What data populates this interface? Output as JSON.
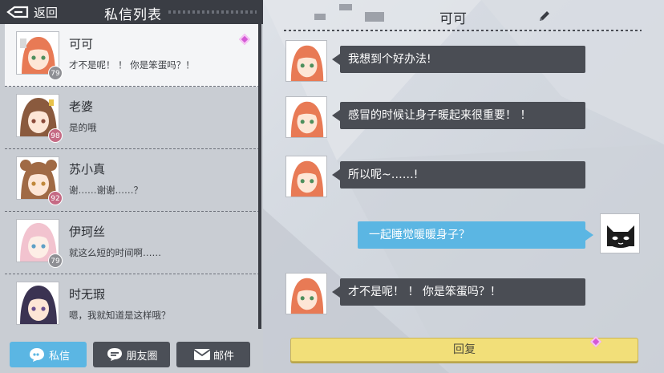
{
  "header": {
    "back_label": "返回",
    "list_title": "私信列表"
  },
  "contacts": [
    {
      "name": "可可",
      "preview": "才不是呢！ ！  你是笨蛋吗？！",
      "level": "79",
      "selected": true,
      "unread": true
    },
    {
      "name": "老婆",
      "preview": "是的哦",
      "level": "98",
      "selected": false,
      "unread": false
    },
    {
      "name": "苏小真",
      "preview": "谢……谢谢……？",
      "level": "92",
      "selected": false,
      "unread": false
    },
    {
      "name": "伊珂丝",
      "preview": "就这么短的时间啊……",
      "level": "79",
      "selected": false,
      "unread": false
    },
    {
      "name": "时无瑕",
      "preview": "嗯，我就知道是这样哦？",
      "level": "",
      "selected": false,
      "unread": false
    }
  ],
  "bottom_nav": {
    "pm_label": "私信",
    "moments_label": "朋友圈",
    "mail_label": "邮件"
  },
  "chat": {
    "title": "可可",
    "messages": [
      {
        "from": "other",
        "text": "我想到个好办法!"
      },
      {
        "from": "other",
        "text": "感冒的时候让身子暖起来很重要！ ！"
      },
      {
        "from": "other",
        "text": "所以呢~……!"
      },
      {
        "from": "me",
        "text": "一起睡觉暖暖身子？"
      },
      {
        "from": "other",
        "text": "才不是呢！ ！  你是笨蛋吗？！"
      }
    ],
    "reply_label": "回复"
  },
  "colors": {
    "accent_blue": "#5bb6e3",
    "dark_panel": "#3a3d44",
    "bubble_dark": "#4a4d54",
    "reply_yellow": "#f2df79",
    "unread_pink": "#d45ad6"
  }
}
